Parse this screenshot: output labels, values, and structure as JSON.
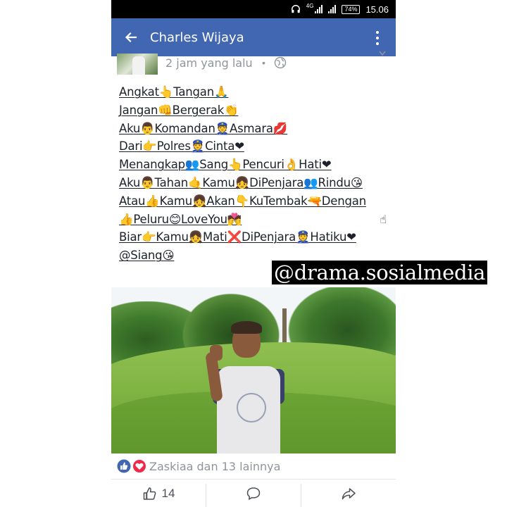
{
  "status_bar": {
    "network": "4G",
    "battery": "74%",
    "time": "15.06"
  },
  "app_bar": {
    "title": "Charles Wijaya",
    "back_icon": "back-arrow-icon",
    "menu_icon": "more-vertical-icon",
    "color": "#4267b2"
  },
  "post": {
    "timestamp": "2 jam yang lalu",
    "separator": "•",
    "privacy_icon": "globe-icon",
    "lines": [
      "Angkat👆Tangan🙏",
      "Jangan👊Bergerak👏",
      "Aku👨Komandan👮Asmara💋",
      "Dari👉Polres👮Cinta❤",
      "Menangkap👥Sang👆Pencuri👌Hati❤",
      "Aku👨Tahan🤙Kamu👧DiPenjara👥Rindu😘",
      "Atau👍Kamu👧Akan👇KuTembak🔫Dengan",
      "👍Peluru😊LoveYou💏",
      "Biar👉Kamu👧Mati❌DiPenjara👮Hatiku❤",
      "@Siang😘"
    ],
    "trailing_emoji": "☝"
  },
  "watermark": "@drama.sosialmedia",
  "reactions": {
    "summary": "Zaskiaa dan 13 lainnya",
    "like_color": "#4267b2",
    "love_color": "#f0284a"
  },
  "actions": {
    "like_count": "14",
    "like_icon": "thumbs-up-icon",
    "comment_icon": "comment-icon",
    "share_icon": "share-icon"
  }
}
